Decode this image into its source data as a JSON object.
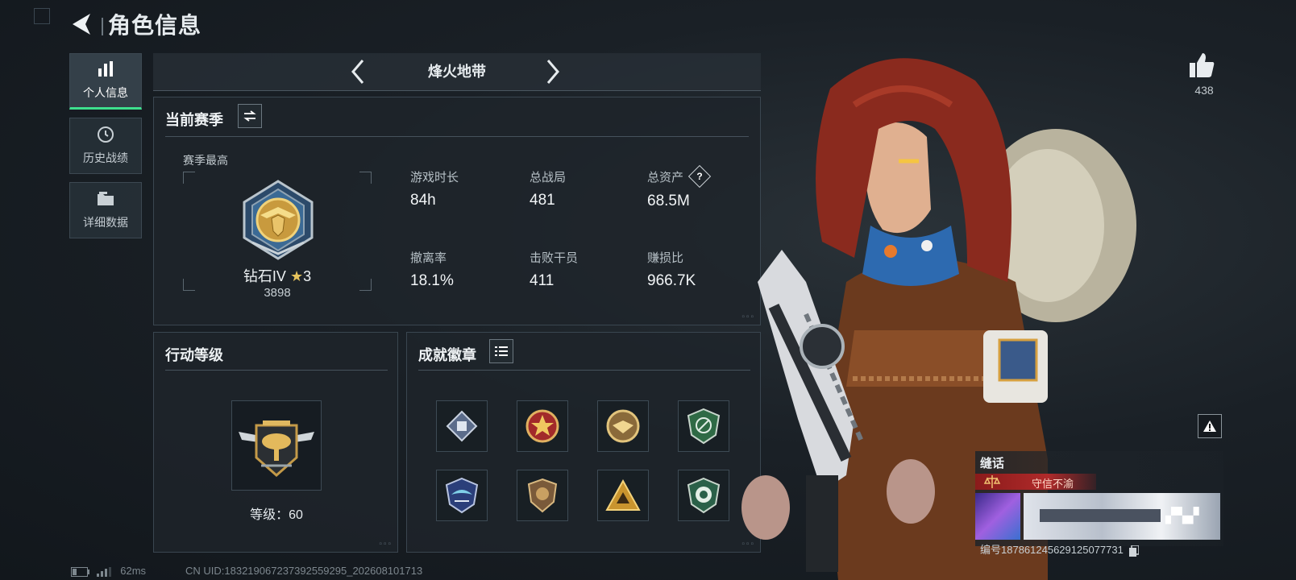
{
  "header": {
    "title": "角色信息"
  },
  "nav": {
    "items": [
      {
        "label": "个人信息",
        "icon": "bar-chart-icon",
        "active": true
      },
      {
        "label": "历史战绩",
        "icon": "history-clock-icon",
        "active": false
      },
      {
        "label": "详细数据",
        "icon": "folder-icon",
        "active": false
      }
    ]
  },
  "mode": {
    "title": "烽火地带"
  },
  "season": {
    "title": "当前赛季",
    "best_label": "赛季最高",
    "rank_name": "钻石IV",
    "rank_stars": "3",
    "rank_score": "3898",
    "stats": [
      {
        "label": "游戏时长",
        "value": "84h"
      },
      {
        "label": "总战局",
        "value": "481"
      },
      {
        "label": "总资产",
        "value": "68.5M",
        "help": "?"
      },
      {
        "label": "撤离率",
        "value": "18.1%"
      },
      {
        "label": "击败干员",
        "value": "411"
      },
      {
        "label": "赚损比",
        "value": "966.7K"
      }
    ]
  },
  "action_level": {
    "title": "行动等级",
    "level_text": "等级：60"
  },
  "achievements": {
    "title": "成就徽章",
    "badges": [
      "diamond-badge-icon",
      "red-star-badge-icon",
      "eagle-coin-badge-icon",
      "green-shield-badge-icon",
      "blue-wing-badge-icon",
      "bronze-shield-badge-icon",
      "gold-triangle-badge-icon",
      "green-emblem-badge-icon"
    ]
  },
  "likes": {
    "count": "438"
  },
  "card": {
    "title": "缝话",
    "motto": "守信不渝",
    "serial": "编号18786124562912507773​1"
  },
  "status": {
    "ping": "62ms",
    "uid": "CN UID:183219067237392559295_202608101713"
  },
  "colors": {
    "accent_green": "#3ee08e",
    "motto_red": "#b02a2a",
    "panel_bg": "#1e252b"
  }
}
